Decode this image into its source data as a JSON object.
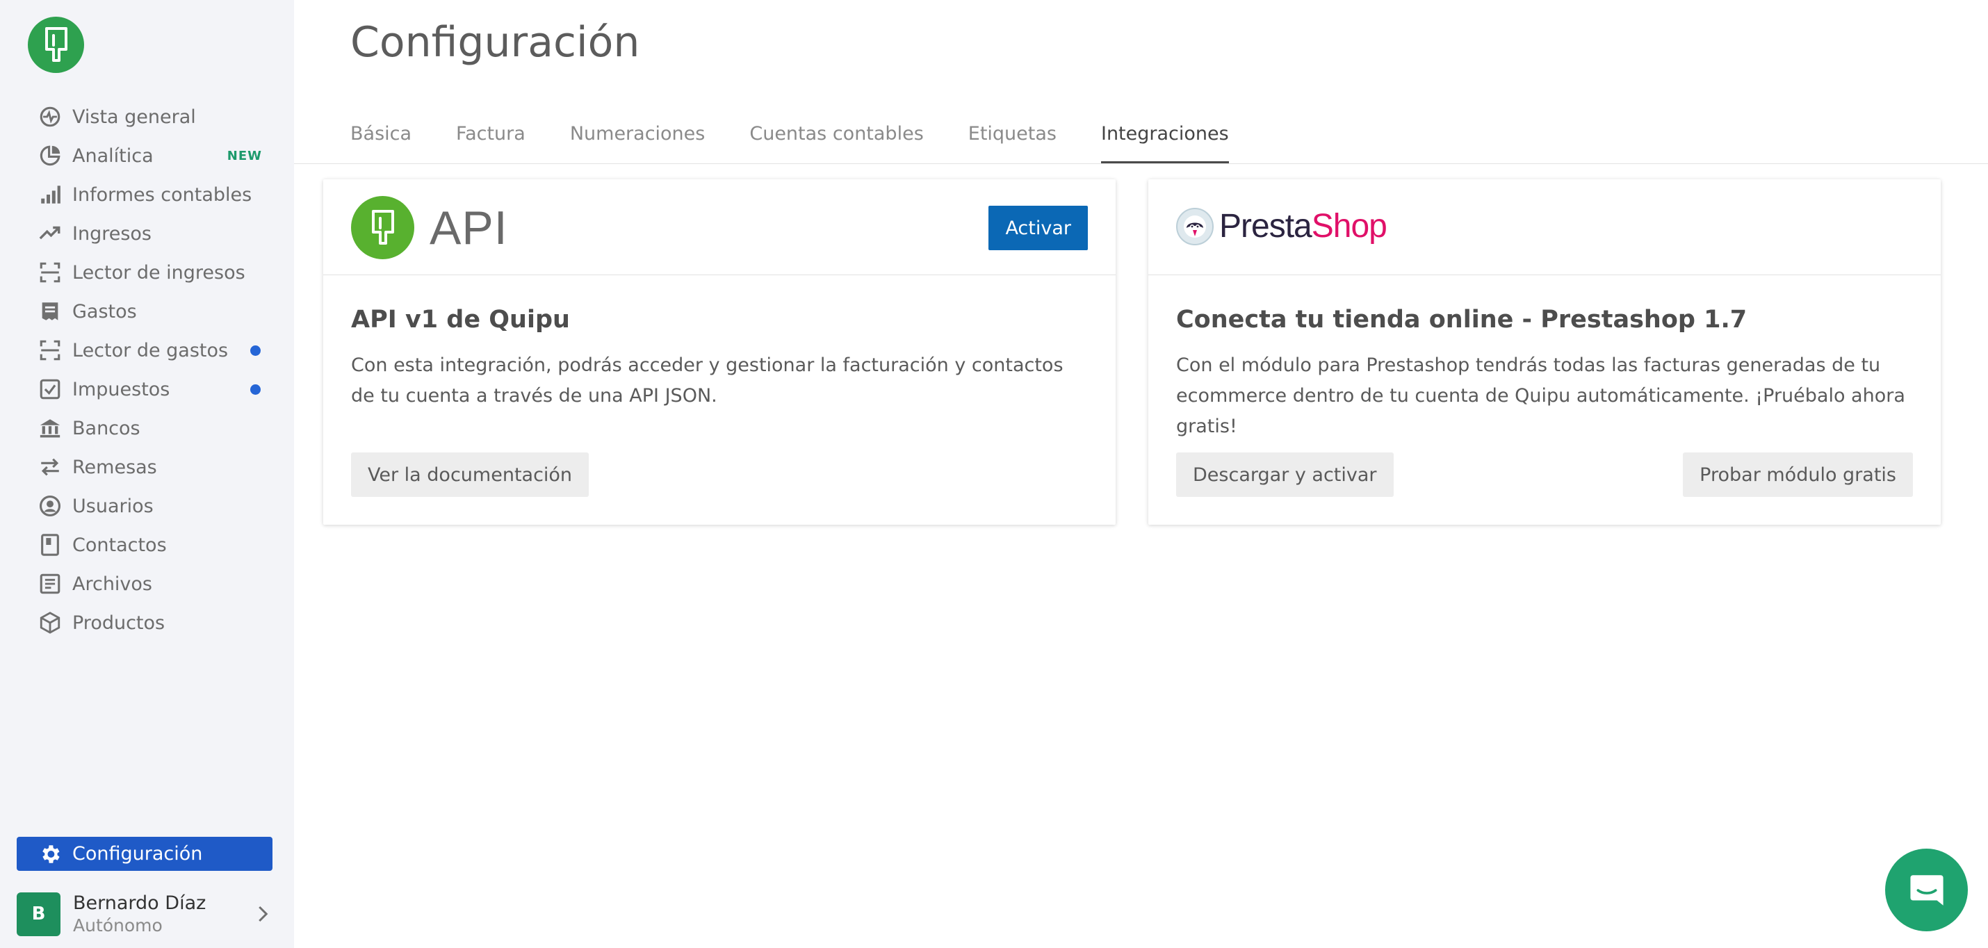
{
  "app": {
    "brand_color": "#2ea14f",
    "accent": "#1f5ac7"
  },
  "sidebar": {
    "logo_icon": "quipu-logo",
    "items": [
      {
        "label": "Vista general",
        "icon": "activity-icon"
      },
      {
        "label": "Analítica",
        "icon": "pie-chart-icon",
        "badge": "NEW"
      },
      {
        "label": "Informes contables",
        "icon": "bar-chart-icon"
      },
      {
        "label": "Ingresos",
        "icon": "trending-up-icon"
      },
      {
        "label": "Lector de ingresos",
        "icon": "scan-icon"
      },
      {
        "label": "Gastos",
        "icon": "receipt-icon"
      },
      {
        "label": "Lector de gastos",
        "icon": "scan-icon",
        "dot": true
      },
      {
        "label": "Impuestos",
        "icon": "checklist-icon",
        "dot": true
      },
      {
        "label": "Bancos",
        "icon": "bank-icon"
      },
      {
        "label": "Remesas",
        "icon": "swap-icon"
      },
      {
        "label": "Usuarios",
        "icon": "user-circle-icon"
      },
      {
        "label": "Contactos",
        "icon": "contact-book-icon"
      },
      {
        "label": "Archivos",
        "icon": "archive-icon"
      },
      {
        "label": "Productos",
        "icon": "box-icon"
      }
    ],
    "config": {
      "label": "Configuración",
      "icon": "gear-icon"
    },
    "user": {
      "initial": "B",
      "name": "Bernardo Díaz",
      "role": "Autónomo"
    }
  },
  "main": {
    "title": "Configuración",
    "tabs": [
      {
        "label": "Básica"
      },
      {
        "label": "Factura"
      },
      {
        "label": "Numeraciones"
      },
      {
        "label": "Cuentas contables"
      },
      {
        "label": "Etiquetas"
      },
      {
        "label": "Integraciones",
        "active": true
      }
    ],
    "cards": {
      "api": {
        "logo_text": "API",
        "activate": "Activar",
        "title": "API v1 de Quipu",
        "description": "Con esta integración, podrás acceder y gestionar la facturación y contactos de tu cuenta a través de una API JSON.",
        "doc_button": "Ver la documentación"
      },
      "prestashop": {
        "logo_text_a": "Presta",
        "logo_text_b": "Shop",
        "title": "Conecta tu tienda online - Prestashop 1.7",
        "description": "Con el módulo para Prestashop tendrás todas las facturas generadas de tu ecommerce dentro de tu cuenta de Quipu automáticamente. ¡Pruébalo ahora gratis!",
        "download_button": "Descargar y activar",
        "try_button": "Probar módulo gratis"
      }
    }
  },
  "chat": {
    "icon": "chat-icon"
  }
}
